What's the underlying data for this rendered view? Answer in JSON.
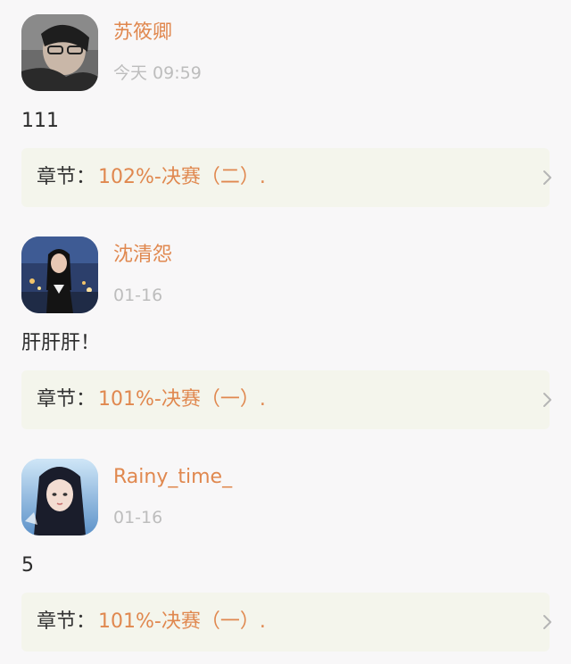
{
  "comments": [
    {
      "username": "苏筱卿",
      "time": "今天 09:59",
      "text": "111",
      "chapter_label": "章节：",
      "chapter_name": "102%-决赛（二）."
    },
    {
      "username": "沈清怨",
      "time": "01-16",
      "text": "肝肝肝！",
      "chapter_label": "章节：",
      "chapter_name": "101%-决赛（一）."
    },
    {
      "username": "Rainy_time_",
      "time": "01-16",
      "text": "5",
      "chapter_label": "章节：",
      "chapter_name": "101%-决赛（一）."
    }
  ],
  "colors": {
    "accent": "#e0884f",
    "background": "#f8f7f8",
    "card": "#f4f5ec",
    "secondary_text": "#bdbdbd"
  },
  "icons": {
    "chapter_arrow": "chevron-right-icon"
  }
}
